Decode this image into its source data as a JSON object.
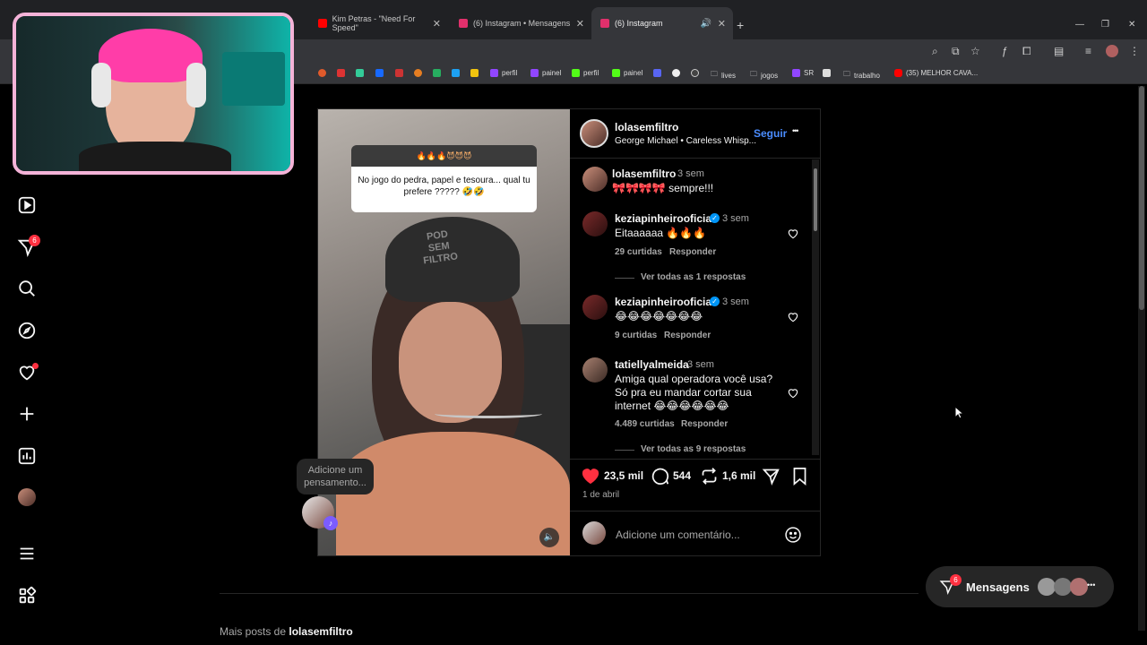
{
  "browser": {
    "tabs": [
      {
        "title": "Kim Petras - \"Need For Speed\"",
        "color": "#ff0000"
      },
      {
        "title": "(6) Instagram • Mensagens",
        "color": "#e1306c"
      },
      {
        "title": "(6) Instagram",
        "color": "#e1306c"
      }
    ],
    "bookmarks": [
      {
        "label": "perfil",
        "color": "#9146ff"
      },
      {
        "label": "painel",
        "color": "#9146ff"
      },
      {
        "label": "perfil",
        "color": "#53fc18"
      },
      {
        "label": "painel",
        "color": "#53fc18"
      },
      {
        "label": "lives",
        "color": "#888888"
      },
      {
        "label": "jogos",
        "color": "#888888"
      },
      {
        "label": "SR",
        "color": "#9146ff"
      },
      {
        "label": "trabalho",
        "color": "#888888"
      },
      {
        "label": "(35) MELHOR CAVA...",
        "color": "#ff0000"
      }
    ]
  },
  "sidebar": {
    "icons": [
      "reels-icon",
      "messages-icon",
      "search-icon",
      "explore-icon",
      "notifications-icon",
      "create-icon",
      "dashboard-icon",
      "profile-avatar",
      "menu-icon",
      "more-apps-icon"
    ],
    "messages_badge": "6"
  },
  "post": {
    "author": "lolasemfiltro",
    "music": "George Michael • Careless Whisp...",
    "follow_label": "Seguir",
    "more_label": "•••",
    "sticker_emojis": "🔥🔥🔥😈😈😈",
    "sticker_question": "No jogo do pedra, papel e tesoura... qual tu prefere ????? 🤣🤣",
    "caption": {
      "user": "lolasemfiltro",
      "time": "3 sem",
      "text": "🎀🎀🎀🎀 sempre!!!"
    },
    "comments": [
      {
        "user": "keziapinheirooficial",
        "verified": true,
        "time": "3 sem",
        "text": "Eitaaaaaa 🔥🔥🔥",
        "likes": "29 curtidas",
        "reply": "Responder",
        "view_replies": "Ver todas as 1 respostas"
      },
      {
        "user": "keziapinheirooficial",
        "verified": true,
        "time": "3 sem",
        "text": "😂😂😂😂😂😂😂",
        "likes": "9 curtidas",
        "reply": "Responder",
        "view_replies": ""
      },
      {
        "user": "tatiellyalmeida",
        "verified": false,
        "time": "3 sem",
        "text": "Amiga qual operadora você usa? Só pra eu mandar cortar sua internet 😂😂😂😂😂😂",
        "likes": "4.489 curtidas",
        "reply": "Responder",
        "view_replies": "Ver todas as 9 respostas"
      }
    ],
    "likes_count": "23,5 mil",
    "comments_count": "544",
    "reposts_count": "1,6 mil",
    "date": "1 de abril",
    "comment_placeholder": "Adicione um comentário..."
  },
  "thought_bubble": "Adicione um pensamento...",
  "more_posts_prefix": "Mais posts de",
  "more_posts_user": "lolasemfiltro",
  "messages_pill": {
    "label": "Mensagens",
    "badge": "6"
  },
  "colors": {
    "like_red": "#ff3040",
    "accent_blue": "#0095f6",
    "follow_blue": "#4a8cff"
  }
}
